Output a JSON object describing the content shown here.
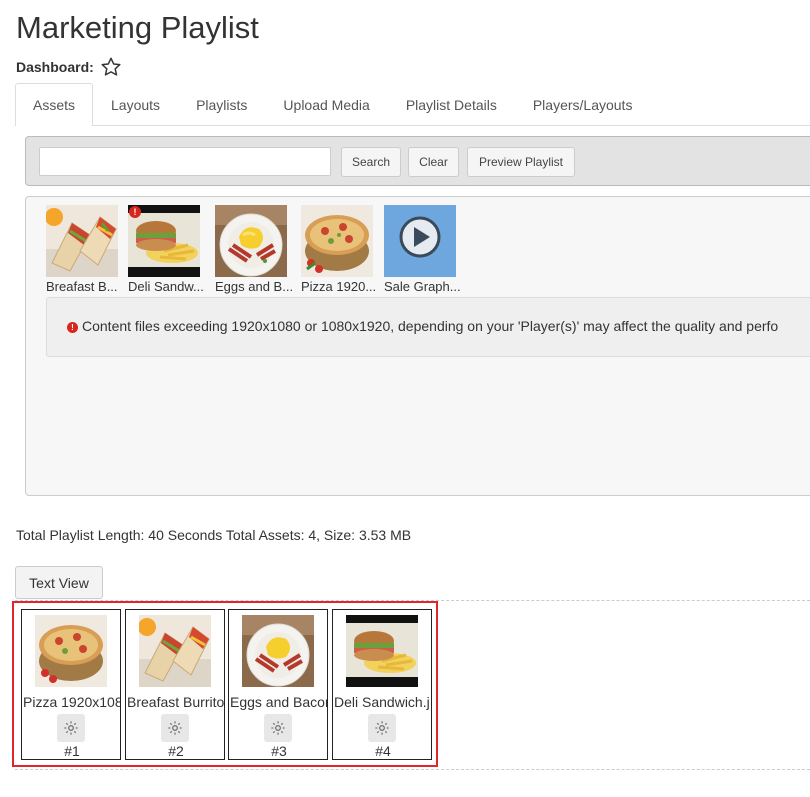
{
  "page": {
    "title": "Marketing Playlist",
    "dashboard_label": "Dashboard:"
  },
  "tabs": [
    {
      "label": "Assets",
      "active": true
    },
    {
      "label": "Layouts"
    },
    {
      "label": "Playlists"
    },
    {
      "label": "Upload Media"
    },
    {
      "label": "Playlist Details"
    },
    {
      "label": "Players/Layouts"
    }
  ],
  "toolbar": {
    "search_placeholder": "",
    "search_value": "",
    "search_label": "Search",
    "clear_label": "Clear",
    "preview_label": "Preview Playlist"
  },
  "assets": [
    {
      "caption": "Breafast B...",
      "thumb": "burrito"
    },
    {
      "caption": "Deli Sandw...",
      "thumb": "sandwich",
      "warning": true
    },
    {
      "caption": "Eggs and B...",
      "thumb": "eggs"
    },
    {
      "caption": "Pizza 1920...",
      "thumb": "pizza"
    },
    {
      "caption": "Sale Graph...",
      "thumb": "play-icon"
    }
  ],
  "notice": {
    "text": "Content files exceeding 1920x1080 or 1080x1920, depending on your 'Player(s)' may affect the quality and perfo"
  },
  "summary": {
    "text": "Total Playlist Length: 40 Seconds Total Assets: 4, Size: 3.53 MB"
  },
  "text_view_label": "Text View",
  "playlist": [
    {
      "name": "Pizza 1920x108",
      "number": "#1",
      "thumb": "pizza"
    },
    {
      "name": "Breafast Burrito",
      "number": "#2",
      "thumb": "burrito"
    },
    {
      "name": "Eggs and Bacon",
      "number": "#3",
      "thumb": "eggs"
    },
    {
      "name": "Deli Sandwich.j",
      "number": "#4",
      "thumb": "sandwich"
    }
  ],
  "colors": {
    "highlight": "#e0262a",
    "warning": "#d9251d",
    "play_tile": "#6ea6de"
  }
}
